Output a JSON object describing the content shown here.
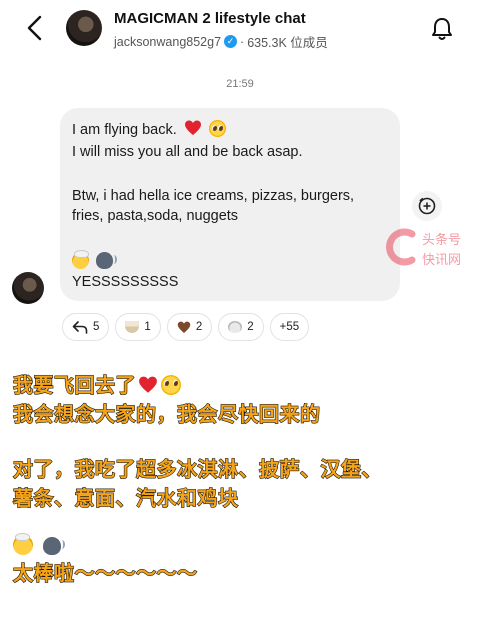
{
  "header": {
    "title": "MAGICMAN 2 lifestyle chat",
    "username": "jacksonwang852g7",
    "separator": "·",
    "members": "635.3K 位成员",
    "verified_color": "#1d9bf0"
  },
  "chat": {
    "timestamp": "21:59",
    "message": {
      "line1": "I am flying back.",
      "line2": "I will miss you all and be back asap.",
      "line3": "Btw, i had hella ice creams, pizzas, burgers,",
      "line4": "fries, pasta,soda, nuggets",
      "line5": "YESSSSSSSSS"
    },
    "reactions": [
      {
        "icon": "reply-icon",
        "count": "5"
      },
      {
        "icon": "noodle-bowl-icon",
        "count": "1"
      },
      {
        "icon": "brown-heart-icon",
        "count": "2"
      },
      {
        "icon": "mouse-face-icon",
        "count": "2"
      },
      {
        "icon": "more-reactions",
        "count": "+55"
      }
    ]
  },
  "watermark": {
    "top": "头条号",
    "bottom": "快讯网"
  },
  "translation": {
    "line1": "我要飞回去了",
    "line2": "我会想念大家的，我会尽快回来的",
    "line3": "对了，我吃了超多冰淇淋、披萨、汉堡、",
    "line4": "薯条、意面、汽水和鸡块",
    "line5": "太棒啦～～～～～～",
    "color": "#f5a41a"
  }
}
